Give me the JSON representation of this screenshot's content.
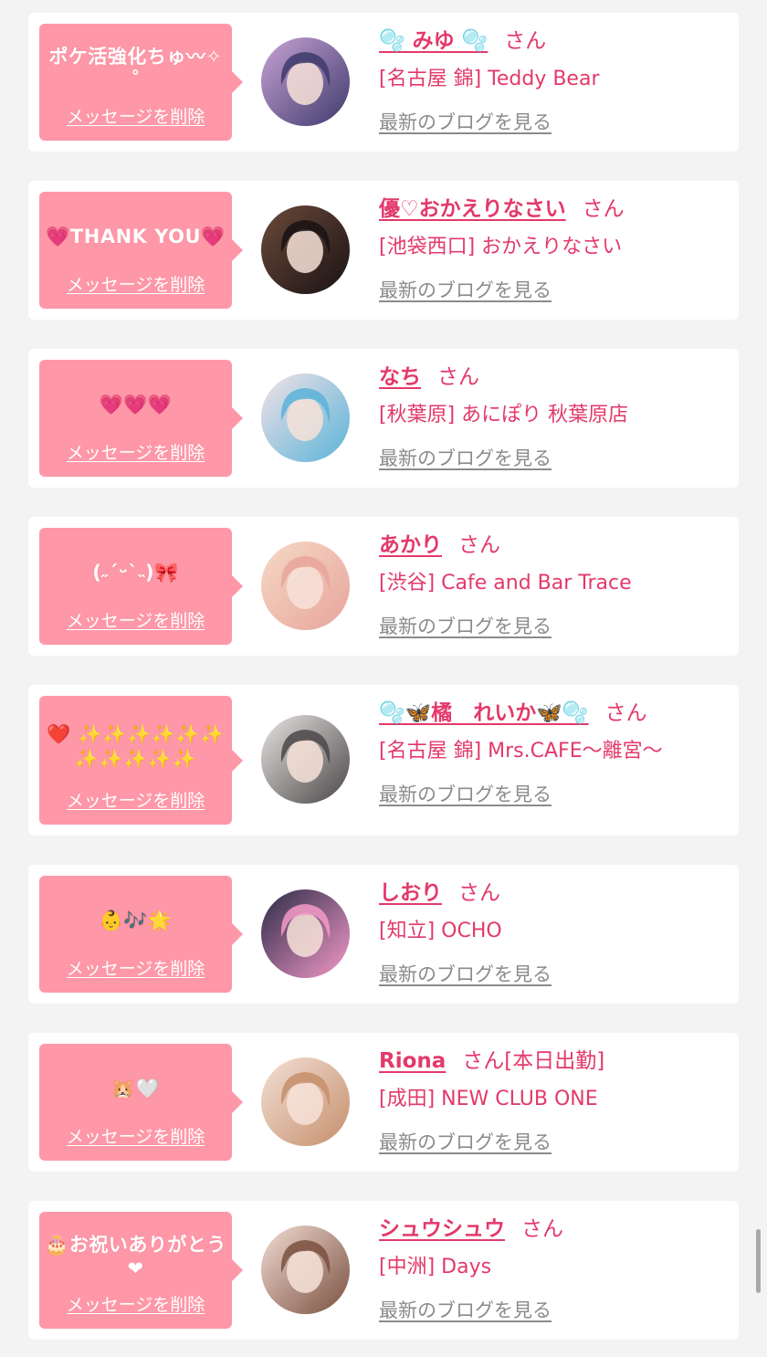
{
  "colors": {
    "page_bg": "#f3f3f3",
    "card_bg": "#ffffff",
    "bubble_pink": "#fe97a7",
    "accent_pink": "#e3396b",
    "link_gray": "#8b8b8b"
  },
  "messages": [
    {
      "message": "ポケ活強化ちゅ〰✧˚",
      "delete_label": "メッセージを削除",
      "name": "🫧 みゆ 🫧",
      "honorific": "さん",
      "status": "",
      "shop": "[名古屋 錦] Teddy Bear",
      "blog_label": "最新のブログを見る",
      "avatar_colors": [
        "#c9a3d6",
        "#3e3a6b"
      ]
    },
    {
      "message": "💗THANK YOU💗",
      "delete_label": "メッセージを削除",
      "name": "優♡おかえりなさい",
      "honorific": "さん",
      "status": "",
      "shop": "[池袋西口] おかえりなさい",
      "blog_label": "最新のブログを見る",
      "avatar_colors": [
        "#6b4a3a",
        "#1a1214"
      ]
    },
    {
      "message": "💗💗💗",
      "delete_label": "メッセージを削除",
      "name": "なち",
      "honorific": "さん",
      "status": "",
      "shop": "[秋葉原] あにぽり 秋葉原店",
      "blog_label": "最新のブログを見る",
      "avatar_colors": [
        "#f2e2e6",
        "#5ab3d8"
      ]
    },
    {
      "message": "(˶ˊᵕˋ˵)🎀",
      "delete_label": "メッセージを削除",
      "name": "あかり",
      "honorific": "さん",
      "status": "",
      "shop": "[渋谷] Cafe and Bar Trace",
      "blog_label": "最新のブログを見る",
      "avatar_colors": [
        "#f6d9c6",
        "#e7a49b"
      ]
    },
    {
      "message": "❤️ ✨✨✨✨✨✨ ✨✨✨✨✨",
      "delete_label": "メッセージを削除",
      "name": "🫧🦋橘　れいか🦋🫧",
      "honorific": "さん",
      "status": "",
      "shop": "[名古屋 錦] Mrs.CAFE〜離宮〜",
      "blog_label": "最新のブログを見る",
      "avatar_colors": [
        "#e8e4e2",
        "#4b4748"
      ]
    },
    {
      "message": "👶🎶🌟",
      "delete_label": "メッセージを削除",
      "name": "しおり",
      "honorific": "さん",
      "status": "",
      "shop": "[知立] OCHO",
      "blog_label": "最新のブログを見る",
      "avatar_colors": [
        "#2b2a47",
        "#f49ac8"
      ]
    },
    {
      "message": "🐹🤍",
      "delete_label": "メッセージを削除",
      "name": "Riona",
      "honorific": "さん",
      "status": "[本日出勤]",
      "shop": "[成田] NEW CLUB ONE",
      "blog_label": "最新のブログを見る",
      "avatar_colors": [
        "#f3e0d6",
        "#c58f6b"
      ]
    },
    {
      "message": "🎂お祝いありがとう❤",
      "delete_label": "メッセージを削除",
      "name": "シュウシュウ",
      "honorific": "さん",
      "status": "",
      "shop": "[中洲] Days",
      "blog_label": "最新のブログを見る",
      "avatar_colors": [
        "#f2dcd3",
        "#7a5040"
      ]
    }
  ]
}
